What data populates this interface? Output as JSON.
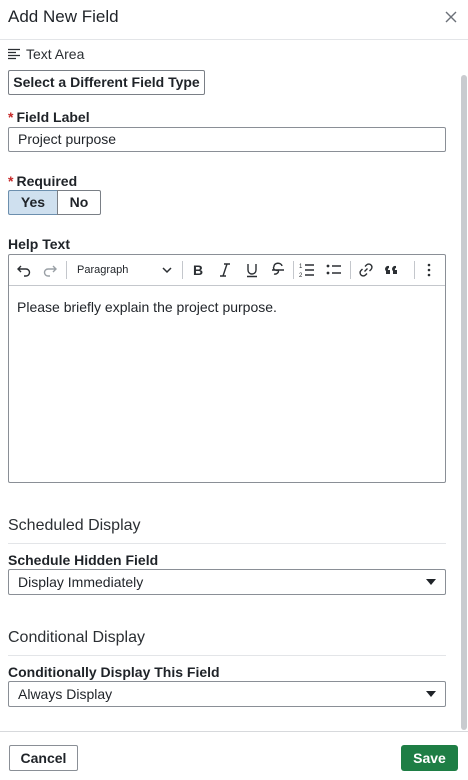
{
  "header": {
    "title": "Add New Field",
    "close_icon": "close-icon"
  },
  "field_type": {
    "icon": "text-area-icon",
    "label": "Text Area",
    "change_button": "Select a Different Field Type"
  },
  "field_label": {
    "label": "Field Label",
    "required_mark": "*",
    "value": "Project purpose"
  },
  "required": {
    "label": "Required",
    "required_mark": "*",
    "options": [
      "Yes",
      "No"
    ],
    "selected": "Yes"
  },
  "help_text": {
    "label": "Help Text",
    "toolbar": {
      "undo_icon": "undo-icon",
      "redo_icon": "redo-icon",
      "block_format": "Paragraph",
      "bold_icon": "bold-icon",
      "italic_icon": "italic-icon",
      "underline_icon": "underline-icon",
      "strikethrough_icon": "strikethrough-icon",
      "numbered_list_icon": "numbered-list-icon",
      "bullet_list_icon": "bullet-list-icon",
      "link_icon": "link-icon",
      "blockquote_icon": "blockquote-icon",
      "more_icon": "more-vertical-icon"
    },
    "content": "Please briefly explain the project purpose."
  },
  "scheduled_display": {
    "section_title": "Scheduled Display",
    "field_label": "Schedule Hidden Field",
    "value": "Display Immediately"
  },
  "conditional_display": {
    "section_title": "Conditional Display",
    "field_label": "Conditionally Display This Field",
    "value": "Always Display"
  },
  "footer": {
    "cancel_label": "Cancel",
    "save_label": "Save"
  },
  "colors": {
    "save_bg": "#1e7e45",
    "required_mark": "#c62828",
    "selected_toggle": "#cfe0ef"
  }
}
